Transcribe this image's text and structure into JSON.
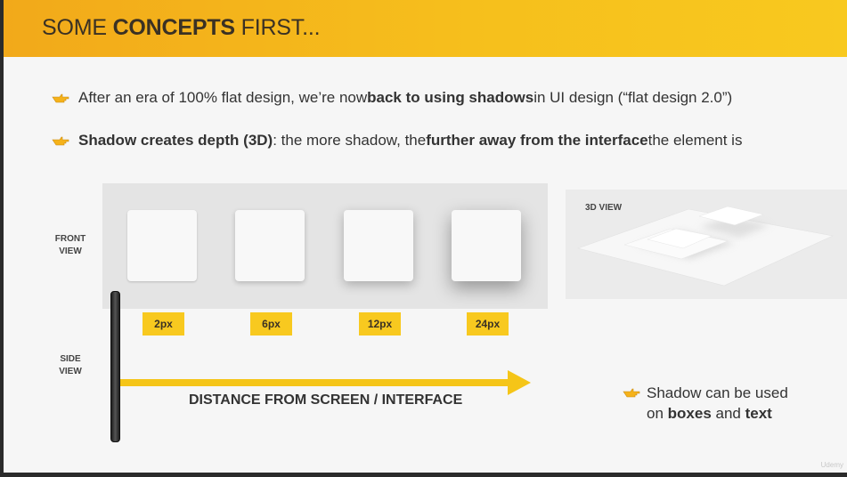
{
  "header": {
    "title_part1": "SOME ",
    "title_bold": "CONCEPTS",
    "title_part2": " FIRST...",
    "accent_color": "#f6bf1c"
  },
  "bullets": [
    {
      "icon": "pointing-hand-icon",
      "t1": "After an era of 100% flat design, we’re now ",
      "b1": "back to using shadows",
      "t2": " in UI design (“flat design 2.0”)",
      "b2": "",
      "t3": ""
    },
    {
      "icon": "pointing-hand-icon",
      "t1": "",
      "b1": "Shadow creates depth (3D)",
      "t2": ": the more shadow, the ",
      "b2": "further away from the interface",
      "t3": " the element is"
    }
  ],
  "front_view_label": "FRONT VIEW",
  "side_view_label": "SIDE VIEW",
  "shadow_sizes": [
    "2px",
    "6px",
    "12px",
    "24px"
  ],
  "view_3d_label": "3D VIEW",
  "distance_label": "DISTANCE FROM SCREEN / INTERFACE",
  "note": {
    "icon": "pointing-hand-icon",
    "line1": "Shadow can be used",
    "line2_prefix": "on ",
    "line2_bold1": "boxes",
    "line2_mid": " and ",
    "line2_bold2": "text"
  },
  "watermark": "Udemy"
}
